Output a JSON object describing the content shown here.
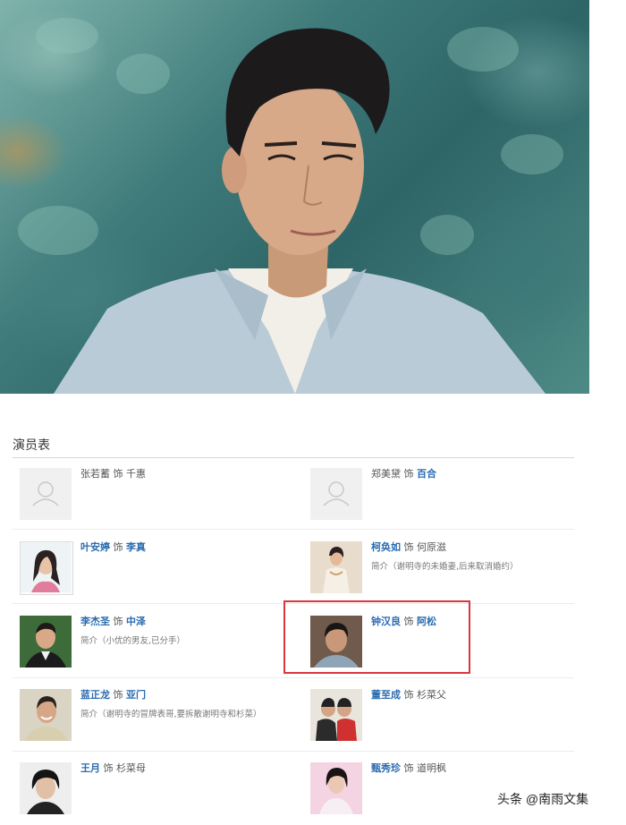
{
  "hero": {
    "alt": "portrait photo"
  },
  "cast": {
    "heading": "演员表",
    "verb": "饰",
    "intro_label": "简介",
    "entries": [
      {
        "actor": "张若蓄",
        "role": "千惠",
        "intro": "",
        "photo": "placeholder-avatar-icon",
        "linked": false
      },
      {
        "actor": "郑美黛",
        "role": "百合",
        "intro": "",
        "photo": "placeholder-avatar-icon",
        "linked": false
      },
      {
        "actor": "叶安婷",
        "role": "李真",
        "intro": "",
        "photo": "actor-photo",
        "linked": true
      },
      {
        "actor": "柯奂如",
        "role": "何原滋",
        "intro": "简介（谢明寺的未婚妻,后来取消婚约）",
        "photo": "actor-photo",
        "linked": true
      },
      {
        "actor": "李杰圣",
        "role": "中泽",
        "intro": "简介（小优的男友,已分手）",
        "photo": "actor-photo",
        "linked": true
      },
      {
        "actor": "钟汉良",
        "role": "阿松",
        "intro": "",
        "photo": "actor-photo",
        "linked": true
      },
      {
        "actor": "蓝正龙",
        "role": "亚门",
        "intro": "简介（谢明寺的冒牌表哥,要拆散谢明寺和杉菜）",
        "photo": "actor-photo",
        "linked": true
      },
      {
        "actor": "董至成",
        "role": "杉菜父",
        "intro": "",
        "photo": "actor-photo",
        "linked": true
      },
      {
        "actor": "王月",
        "role": "杉菜母",
        "intro": "",
        "photo": "actor-photo",
        "linked": true
      },
      {
        "actor": "甄秀珍",
        "role": "道明枫",
        "intro": "",
        "photo": "actor-photo",
        "linked": true
      }
    ]
  },
  "watermark": "头条 @南雨文集",
  "colors": {
    "link": "#2a6bb0",
    "highlight": "#d9363e"
  }
}
